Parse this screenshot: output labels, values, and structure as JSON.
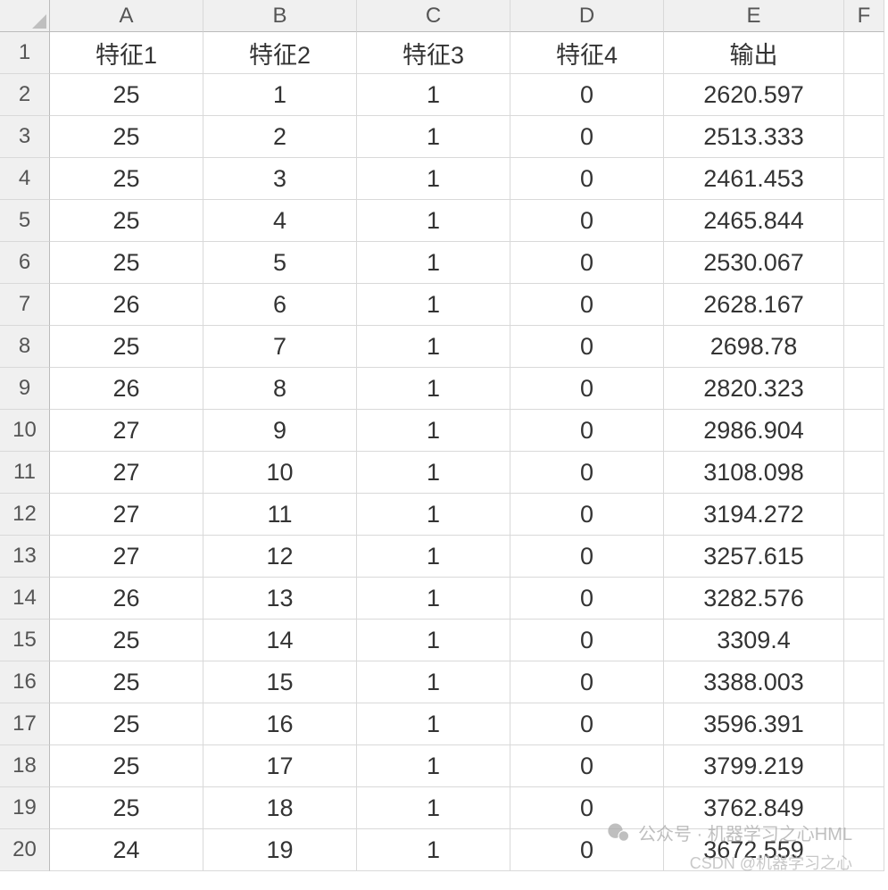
{
  "columns": [
    "A",
    "B",
    "C",
    "D",
    "E",
    "F"
  ],
  "headerRow": {
    "rowNum": "1",
    "cells": [
      "特征1",
      "特征2",
      "特征3",
      "特征4",
      "输出",
      ""
    ]
  },
  "dataRows": [
    {
      "rowNum": "2",
      "cells": [
        "25",
        "1",
        "1",
        "0",
        "2620.597",
        ""
      ]
    },
    {
      "rowNum": "3",
      "cells": [
        "25",
        "2",
        "1",
        "0",
        "2513.333",
        ""
      ]
    },
    {
      "rowNum": "4",
      "cells": [
        "25",
        "3",
        "1",
        "0",
        "2461.453",
        ""
      ]
    },
    {
      "rowNum": "5",
      "cells": [
        "25",
        "4",
        "1",
        "0",
        "2465.844",
        ""
      ]
    },
    {
      "rowNum": "6",
      "cells": [
        "25",
        "5",
        "1",
        "0",
        "2530.067",
        ""
      ]
    },
    {
      "rowNum": "7",
      "cells": [
        "26",
        "6",
        "1",
        "0",
        "2628.167",
        ""
      ]
    },
    {
      "rowNum": "8",
      "cells": [
        "25",
        "7",
        "1",
        "0",
        "2698.78",
        ""
      ]
    },
    {
      "rowNum": "9",
      "cells": [
        "26",
        "8",
        "1",
        "0",
        "2820.323",
        ""
      ]
    },
    {
      "rowNum": "10",
      "cells": [
        "27",
        "9",
        "1",
        "0",
        "2986.904",
        ""
      ]
    },
    {
      "rowNum": "11",
      "cells": [
        "27",
        "10",
        "1",
        "0",
        "3108.098",
        ""
      ]
    },
    {
      "rowNum": "12",
      "cells": [
        "27",
        "11",
        "1",
        "0",
        "3194.272",
        ""
      ]
    },
    {
      "rowNum": "13",
      "cells": [
        "27",
        "12",
        "1",
        "0",
        "3257.615",
        ""
      ]
    },
    {
      "rowNum": "14",
      "cells": [
        "26",
        "13",
        "1",
        "0",
        "3282.576",
        ""
      ]
    },
    {
      "rowNum": "15",
      "cells": [
        "25",
        "14",
        "1",
        "0",
        "3309.4",
        ""
      ]
    },
    {
      "rowNum": "16",
      "cells": [
        "25",
        "15",
        "1",
        "0",
        "3388.003",
        ""
      ]
    },
    {
      "rowNum": "17",
      "cells": [
        "25",
        "16",
        "1",
        "0",
        "3596.391",
        ""
      ]
    },
    {
      "rowNum": "18",
      "cells": [
        "25",
        "17",
        "1",
        "0",
        "3799.219",
        ""
      ]
    },
    {
      "rowNum": "19",
      "cells": [
        "25",
        "18",
        "1",
        "0",
        "3762.849",
        ""
      ]
    },
    {
      "rowNum": "20",
      "cells": [
        "24",
        "19",
        "1",
        "0",
        "3672.559",
        ""
      ]
    }
  ],
  "watermark1": "公众号 · 机器学习之心HML",
  "watermark2": "CSDN @机器学习之心"
}
